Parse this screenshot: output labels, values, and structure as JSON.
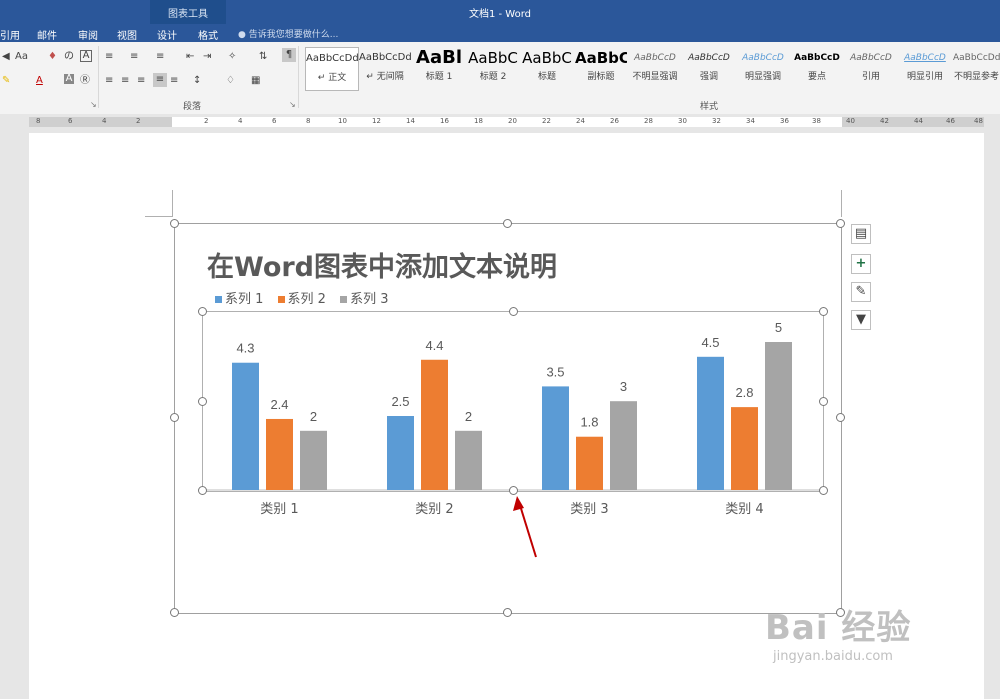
{
  "titlebar": {
    "title": "文档1 - Word",
    "context_title": "图表工具"
  },
  "tabs": [
    {
      "label": "引用"
    },
    {
      "label": "邮件"
    },
    {
      "label": "审阅"
    },
    {
      "label": "视图"
    },
    {
      "label": "设计"
    },
    {
      "label": "格式"
    }
  ],
  "tellme": {
    "text": "告诉我您想要做什么..."
  },
  "ribbon": {
    "font_group": {
      "font_size_button": "Aa",
      "font_color_letter": "A"
    },
    "paragraph_label": "段落",
    "styles_label": "样式",
    "styles": [
      {
        "sample": "AaBbCcDd",
        "name": "↵ 正文"
      },
      {
        "sample": "AaBbCcDd",
        "name": "↵ 无间隔"
      },
      {
        "sample": "AaBl",
        "name": "标题 1"
      },
      {
        "sample": "AaBbC",
        "name": "标题 2"
      },
      {
        "sample": "AaBbC",
        "name": "标题"
      },
      {
        "sample": "AaBbC",
        "name": "副标题"
      },
      {
        "sample": "AaBbCcD",
        "name": "不明显强调"
      },
      {
        "sample": "AaBbCcD",
        "name": "强调"
      },
      {
        "sample": "AaBbCcD",
        "name": "明显强调"
      },
      {
        "sample": "AaBbCcD",
        "name": "要点"
      },
      {
        "sample": "AaBbCcD",
        "name": "引用"
      },
      {
        "sample": "AaBbCcD",
        "name": "明显引用"
      },
      {
        "sample": "AaBbCcDd",
        "name": "不明显参考"
      }
    ]
  },
  "ruler": {
    "labels": [
      "8",
      "6",
      "4",
      "2",
      "2",
      "4",
      "6",
      "8",
      "10",
      "12",
      "14",
      "16",
      "18",
      "20",
      "22",
      "24",
      "26",
      "28",
      "30",
      "32",
      "34",
      "36",
      "38",
      "40",
      "42",
      "44",
      "46",
      "48"
    ]
  },
  "side_buttons": [
    "layout-options-icon",
    "add-chart-element-icon",
    "chart-styles-icon",
    "chart-filter-icon"
  ],
  "watermark": {
    "text": "Bai 经验",
    "sub": "jingyan.baidu.com"
  },
  "colors": {
    "series1": "#5b9bd5",
    "series2": "#ed7d31",
    "series3": "#a5a5a5",
    "accent": "#2b579a",
    "arrow": "#c00000"
  },
  "chart_data": {
    "type": "bar",
    "title": "在Word图表中添加文本说明",
    "categories": [
      "类别 1",
      "类别 2",
      "类别 3",
      "类别 4"
    ],
    "series": [
      {
        "name": "系列 1",
        "values": [
          4.3,
          2.5,
          3.5,
          4.5
        ]
      },
      {
        "name": "系列 2",
        "values": [
          2.4,
          4.4,
          1.8,
          2.8
        ]
      },
      {
        "name": "系列 3",
        "values": [
          2,
          2,
          3,
          5
        ]
      }
    ],
    "legend_position": "top-left",
    "grid": false,
    "ylim": [
      0,
      5
    ]
  }
}
